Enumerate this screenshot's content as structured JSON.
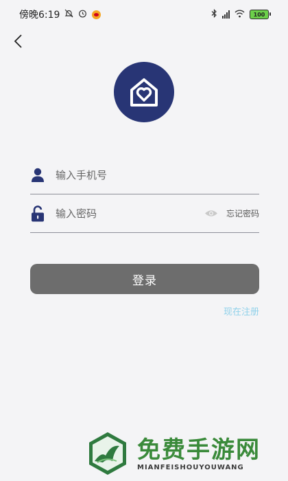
{
  "status_bar": {
    "time": "傍晚6:19",
    "battery": "100"
  },
  "login": {
    "phone_placeholder": "输入手机号",
    "password_placeholder": "输入密码",
    "forgot_password": "忘记密码",
    "login_button": "登录",
    "register_link": "现在注册"
  },
  "watermark": {
    "title": "免费手游网",
    "subtitle": "MIANFEISHOUYOUWANG"
  },
  "colors": {
    "brand": "#283575",
    "button": "#6d6d6d",
    "register": "#8fd1ea",
    "watermark": "#3a8a3a"
  },
  "icons": {
    "back": "chevron-left-icon",
    "logo": "house-heart-icon",
    "phone_field": "user-icon",
    "password_field": "unlock-icon",
    "visibility": "eye-icon"
  }
}
